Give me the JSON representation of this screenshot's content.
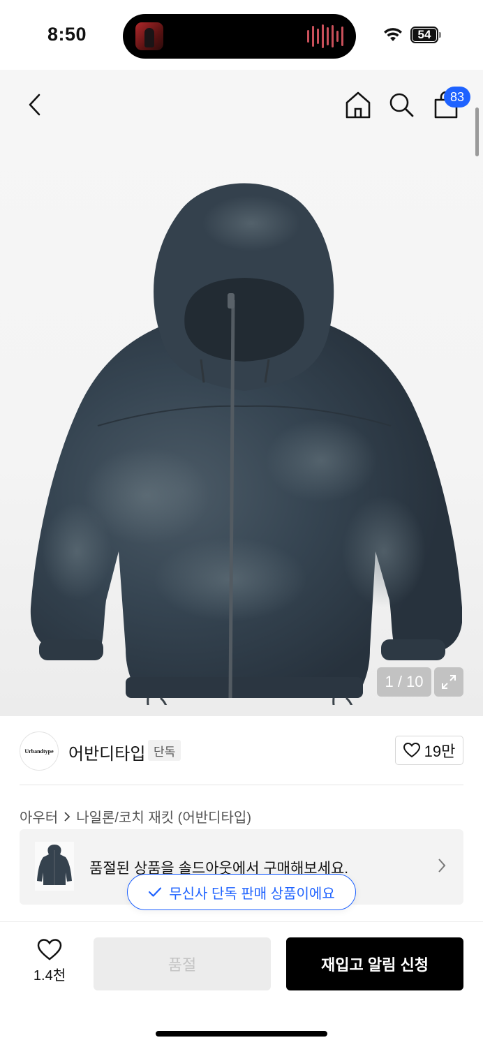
{
  "status_bar": {
    "time": "8:50",
    "battery": "54"
  },
  "header": {
    "back_icon": "chevron-left-icon",
    "home_icon": "home-icon",
    "search_icon": "search-icon",
    "cart_icon": "shopping-bag-icon",
    "cart_count": "83"
  },
  "gallery": {
    "counter": "1 / 10",
    "current": 1,
    "total": 10,
    "expand_icon": "expand-icon"
  },
  "brand": {
    "logo_text": "Urbandtype",
    "name": "어반디타입",
    "tag": "단독",
    "likes": "19만"
  },
  "breadcrumb": {
    "category": "아우터",
    "subcategory": "나일론/코치 재킷 (어반디타입)"
  },
  "soldout_banner": {
    "message": "품절된 상품을 솔드아웃에서 구매해보세요."
  },
  "exclusive_chip": {
    "label": "무신사 단독 판매 상품이에요"
  },
  "bottom_bar": {
    "wish_count": "1.4천",
    "soldout_label": "품절",
    "restock_label": "재입고 알림 신청"
  },
  "colors": {
    "accent": "#1e62ff",
    "primary_button": "#000000",
    "disabled_button": "#ececec"
  }
}
